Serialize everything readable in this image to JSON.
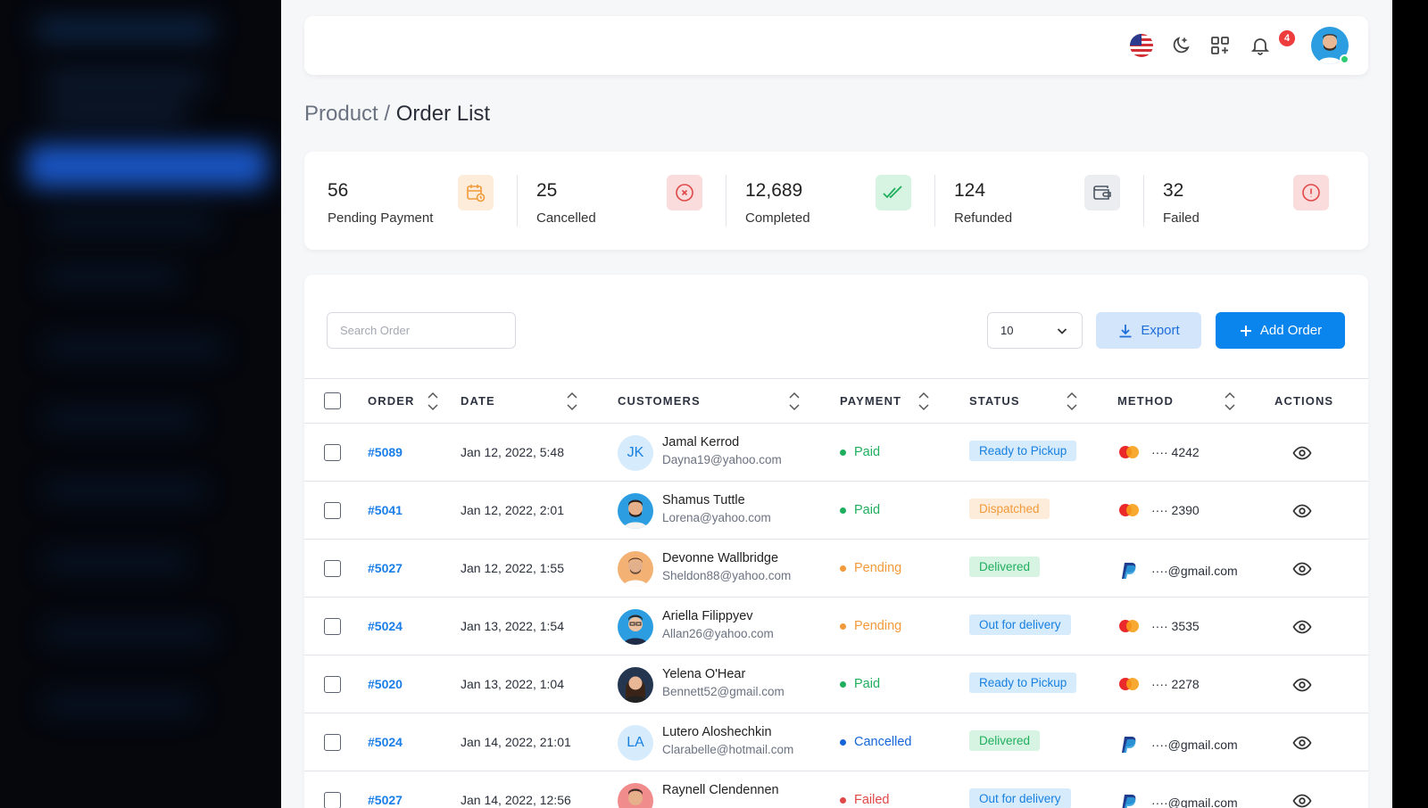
{
  "header": {
    "notification_count": "4"
  },
  "breadcrumb": {
    "parent": "Product",
    "separator": " / ",
    "current": "Order List"
  },
  "stats": [
    {
      "value": "56",
      "label": "Pending Payment",
      "icon": "calendar-clock-icon",
      "color": "#f29a3a"
    },
    {
      "value": "25",
      "label": "Cancelled",
      "icon": "x-circle-icon",
      "color": "#e04848"
    },
    {
      "value": "12,689",
      "label": "Completed",
      "icon": "double-check-icon",
      "color": "#1fae5e"
    },
    {
      "value": "124",
      "label": "Refunded",
      "icon": "wallet-icon",
      "color": "#4b5563"
    },
    {
      "value": "32",
      "label": "Failed",
      "icon": "alert-circle-icon",
      "color": "#e04848"
    }
  ],
  "toolbar": {
    "search_placeholder": "Search Order",
    "per_page": "10",
    "export_label": "Export",
    "add_label": "Add Order"
  },
  "table": {
    "columns": [
      "ORDER",
      "DATE",
      "CUSTOMERS",
      "PAYMENT",
      "STATUS",
      "METHOD",
      "ACTIONS"
    ],
    "rows": [
      {
        "order": "#5089",
        "date": "Jan 12, 2022, 5:48",
        "initials": "JK",
        "name": "Jamal Kerrod",
        "email": "Dayna19@yahoo.com",
        "payment": "Paid",
        "status": "Ready to  Pickup",
        "method": "···· 4242"
      },
      {
        "order": "#5041",
        "date": "Jan 12, 2022, 2:01",
        "initials": "",
        "name": "Shamus Tuttle",
        "email": "Lorena@yahoo.com",
        "payment": "Paid",
        "status": "Dispatched",
        "method": "···· 2390"
      },
      {
        "order": "#5027",
        "date": "Jan 12, 2022, 1:55",
        "initials": "",
        "name": "Devonne Wallbridge",
        "email": "Sheldon88@yahoo.com",
        "payment": "Pending",
        "status": "Delivered",
        "method": "····@gmail.com"
      },
      {
        "order": "#5024",
        "date": "Jan 13, 2022, 1:54",
        "initials": "",
        "name": "Ariella Filippyev",
        "email": "Allan26@yahoo.com",
        "payment": "Pending",
        "status": "Out for delivery",
        "method": "···· 3535"
      },
      {
        "order": "#5020",
        "date": "Jan 13, 2022, 1:04",
        "initials": "",
        "name": "Yelena O'Hear",
        "email": "Bennett52@gmail.com",
        "payment": "Paid",
        "status": "Ready to  Pickup",
        "method": "···· 2278"
      },
      {
        "order": "#5024",
        "date": "Jan 14, 2022, 21:01",
        "initials": "LA",
        "name": "Lutero Aloshechkin",
        "email": "Clarabelle@hotmail.com",
        "payment": "Cancelled",
        "status": "Delivered",
        "method": "····@gmail.com"
      },
      {
        "order": "#5027",
        "date": "Jan 14, 2022, 12:56",
        "initials": "",
        "name": "Raynell Clendennen",
        "email": "",
        "payment": "Failed",
        "status": "Out for delivery",
        "method": "····@gmail.com"
      }
    ]
  },
  "colors": {
    "primary": "#0b85ee",
    "paid": "#1fae5e",
    "pending": "#f29a3a",
    "cancelled": "#1565d8",
    "failed": "#e04848"
  }
}
